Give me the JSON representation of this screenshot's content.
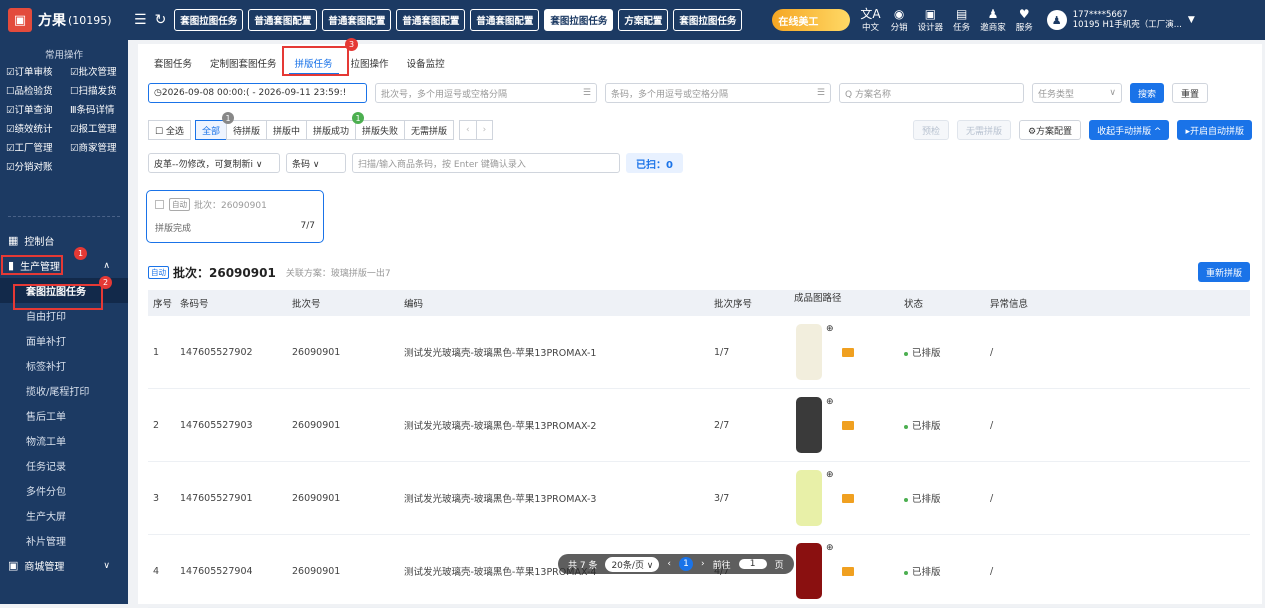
{
  "app": {
    "name": "方果",
    "count": "(10195)",
    "logo_char": "▣"
  },
  "top_tabs": [
    "套图拉图任务",
    "普通套图配置",
    "普通套图配置",
    "普通套图配置",
    "普通套图配置",
    "套图拉图任务",
    "方案配置",
    "套图拉图任务"
  ],
  "top_active_index": 5,
  "promo": "在线美工",
  "quick": [
    {
      "icon": "translate-icon",
      "glyph": "文A",
      "label": "中文"
    },
    {
      "icon": "distribute-icon",
      "glyph": "◉",
      "label": "分销"
    },
    {
      "icon": "designer-icon",
      "glyph": "▣",
      "label": "设计器"
    },
    {
      "icon": "task-icon",
      "glyph": "▤",
      "label": "任务"
    },
    {
      "icon": "invite-icon",
      "glyph": "♟",
      "label": "邀商家"
    },
    {
      "icon": "service-icon",
      "glyph": "♥",
      "label": "服务"
    }
  ],
  "user": {
    "line1": "177****5667",
    "line2": "10195 H1手机壳（工厂演..."
  },
  "sidebar": {
    "title": "常用操作",
    "shortcuts": [
      "☑订单审核",
      "☑批次管理",
      "☐品检验货",
      "☐扫描发货",
      "☑订单查询",
      "Ⅲ条码详情",
      "☑绩效统计",
      "☑报工管理",
      "☑工厂管理",
      "☑商家管理",
      "☑分销对账"
    ],
    "menu": [
      {
        "label": "控制台",
        "icon": "▦",
        "type": "top"
      },
      {
        "label": "生产管理",
        "icon": "▮",
        "type": "top",
        "chev": "∧"
      },
      {
        "label": "套图拉图任务",
        "type": "active-sub"
      },
      {
        "label": "自由打印",
        "type": "sub"
      },
      {
        "label": "面单补打",
        "type": "sub"
      },
      {
        "label": "标签补打",
        "type": "sub"
      },
      {
        "label": "揽收/尾程打印",
        "type": "sub"
      },
      {
        "label": "售后工单",
        "type": "sub"
      },
      {
        "label": "物流工单",
        "type": "sub"
      },
      {
        "label": "任务记录",
        "type": "sub"
      },
      {
        "label": "多件分包",
        "type": "sub"
      },
      {
        "label": "生产大屏",
        "type": "sub"
      },
      {
        "label": "补片管理",
        "type": "sub"
      },
      {
        "label": "商城管理",
        "icon": "▣",
        "type": "top",
        "chev": "∨"
      }
    ]
  },
  "subtabs": [
    "套图任务",
    "定制图套图任务",
    "拼版任务",
    "拉图操作",
    "设备监控"
  ],
  "subtab_active": 2,
  "filters": {
    "date_range": "◷2026-09-08 00:00:(   -   2026-09-11 23:59:!",
    "batch_placeholder": "批次号，多个用逗号或空格分隔",
    "barcode_placeholder": "条码，多个用逗号或空格分隔",
    "plan_placeholder": "Q 方案名称",
    "task_type": "任务类型",
    "search": "搜索",
    "reset": "重置"
  },
  "status_tabs": [
    "全选",
    "全部",
    "待拼版",
    "拼版中",
    "拼版成功",
    "拼版失败",
    "无需拼版"
  ],
  "badges": {
    "one": "1",
    "two": "2",
    "three": "3",
    "all_count": "1",
    "success_count": "1"
  },
  "actions": {
    "precheck": "预检",
    "no_imposition": "无需拼版",
    "plan_config": "⚙方案配置",
    "manual_collapse": "收起手动拼版 ^",
    "auto_start": "▸开启自动拼版"
  },
  "scan": {
    "preset": "皮革--勿修改，可复制新i ∨",
    "type": "条码 ∨",
    "placeholder": "扫描/输入商品条码，按 Enter 键确认录入",
    "count": "已扫：0"
  },
  "batch_card": {
    "tag": "自动",
    "label": "批次：26090901",
    "status": "拼版完成",
    "progress": "7/7"
  },
  "batch_header": {
    "tag": "自动",
    "title": "批次：26090901",
    "plan": "关联方案：玻璃拼版一出7",
    "rebuild": "重新拼版"
  },
  "columns": [
    "序号",
    "条码号",
    "批次号",
    "编码",
    "批次序号",
    "成品图路径",
    "状态",
    "异常信息"
  ],
  "rows": [
    {
      "no": "1",
      "barcode": "147605527902",
      "batch": "26090901",
      "code": "测试发光玻璃壳-玻璃黑色-苹果13PROMAX-1",
      "seq": "1/7",
      "status": "已排版",
      "error": "/",
      "thumb": "#f2eedd"
    },
    {
      "no": "2",
      "barcode": "147605527903",
      "batch": "26090901",
      "code": "测试发光玻璃壳-玻璃黑色-苹果13PROMAX-2",
      "seq": "2/7",
      "status": "已排版",
      "error": "/",
      "thumb": "#3a3a3a"
    },
    {
      "no": "3",
      "barcode": "147605527901",
      "batch": "26090901",
      "code": "测试发光玻璃壳-玻璃黑色-苹果13PROMAX-3",
      "seq": "3/7",
      "status": "已排版",
      "error": "/",
      "thumb": "#e8f0a8"
    },
    {
      "no": "4",
      "barcode": "147605527904",
      "batch": "26090901",
      "code": "测试发光玻璃壳-玻璃黑色-苹果13PROMAX-4",
      "seq": "4/7",
      "status": "已排版",
      "error": "/",
      "thumb": "#8a1010"
    }
  ],
  "pager": {
    "total": "共 7 条",
    "size": "20条/页 ∨",
    "page": "1",
    "goto": "前往",
    "goto_val": "1",
    "unit": "页"
  }
}
